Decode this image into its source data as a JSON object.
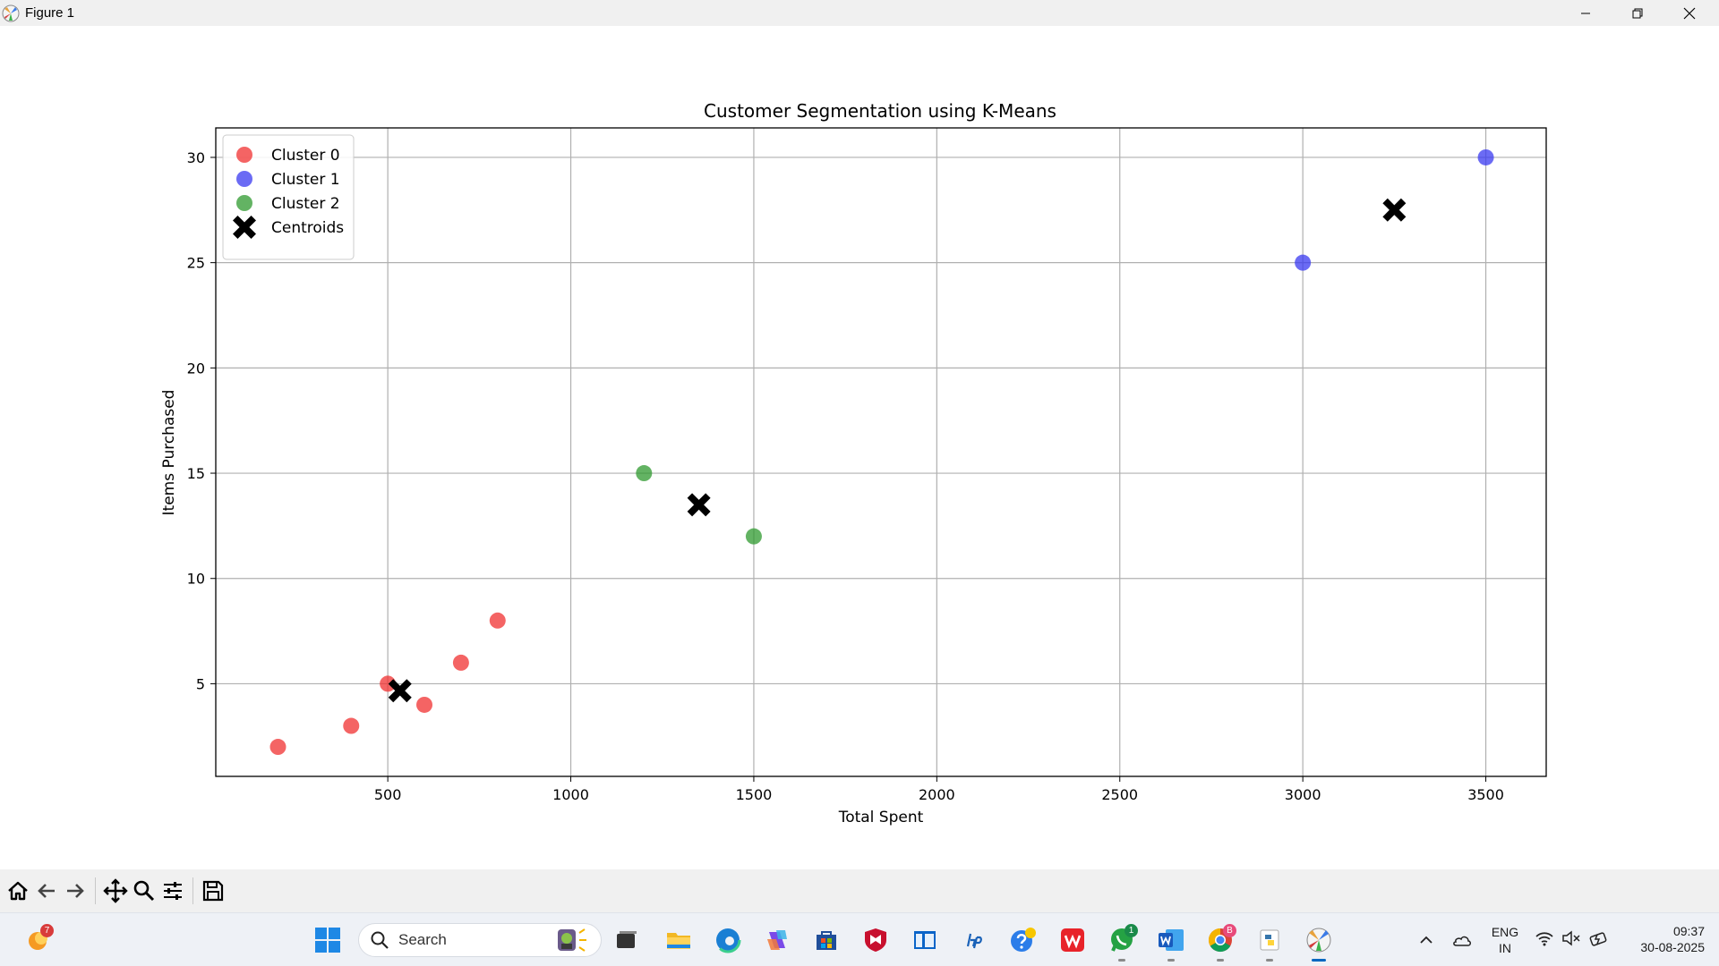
{
  "window": {
    "title": "Figure 1",
    "controls": [
      "minimize",
      "restore",
      "close"
    ]
  },
  "chart_data": {
    "type": "scatter",
    "title": "Customer Segmentation using K-Means",
    "xlabel": "Total Spent",
    "ylabel": "Items Purchased",
    "xlim": [
      30,
      3665
    ],
    "ylim": [
      0.6,
      31.4
    ],
    "xticks": [
      500,
      1000,
      1500,
      2000,
      2500,
      3000,
      3500
    ],
    "yticks": [
      5,
      10,
      15,
      20,
      25,
      30
    ],
    "grid": true,
    "legend_position": "upper-left",
    "series": [
      {
        "name": "Cluster 0",
        "color": "#f03030",
        "marker": "circle",
        "points": [
          [
            200,
            2
          ],
          [
            400,
            3
          ],
          [
            500,
            5
          ],
          [
            600,
            4
          ],
          [
            700,
            6
          ],
          [
            800,
            8
          ]
        ]
      },
      {
        "name": "Cluster 1",
        "color": "#3a3af0",
        "marker": "circle",
        "points": [
          [
            3000,
            25
          ],
          [
            3500,
            30
          ]
        ]
      },
      {
        "name": "Cluster 2",
        "color": "#2f9a2f",
        "marker": "circle",
        "points": [
          [
            1200,
            15
          ],
          [
            1500,
            12
          ]
        ]
      },
      {
        "name": "Centroids",
        "color": "#000000",
        "marker": "X",
        "points": [
          [
            533.33,
            4.67
          ],
          [
            3250,
            27.5
          ],
          [
            1350,
            13.5
          ]
        ]
      }
    ]
  },
  "toolbar": {
    "buttons": [
      "home-icon",
      "back-icon",
      "forward-icon",
      "pan-icon",
      "zoom-icon",
      "configure-subplots-icon",
      "save-icon"
    ]
  },
  "taskbar": {
    "weather_badge": "7",
    "search_placeholder": "Search",
    "whatsapp_badge": "1",
    "chrome_badge": "B",
    "lang_line1": "ENG",
    "lang_line2": "IN",
    "time": "09:37",
    "date": "30-08-2025"
  }
}
